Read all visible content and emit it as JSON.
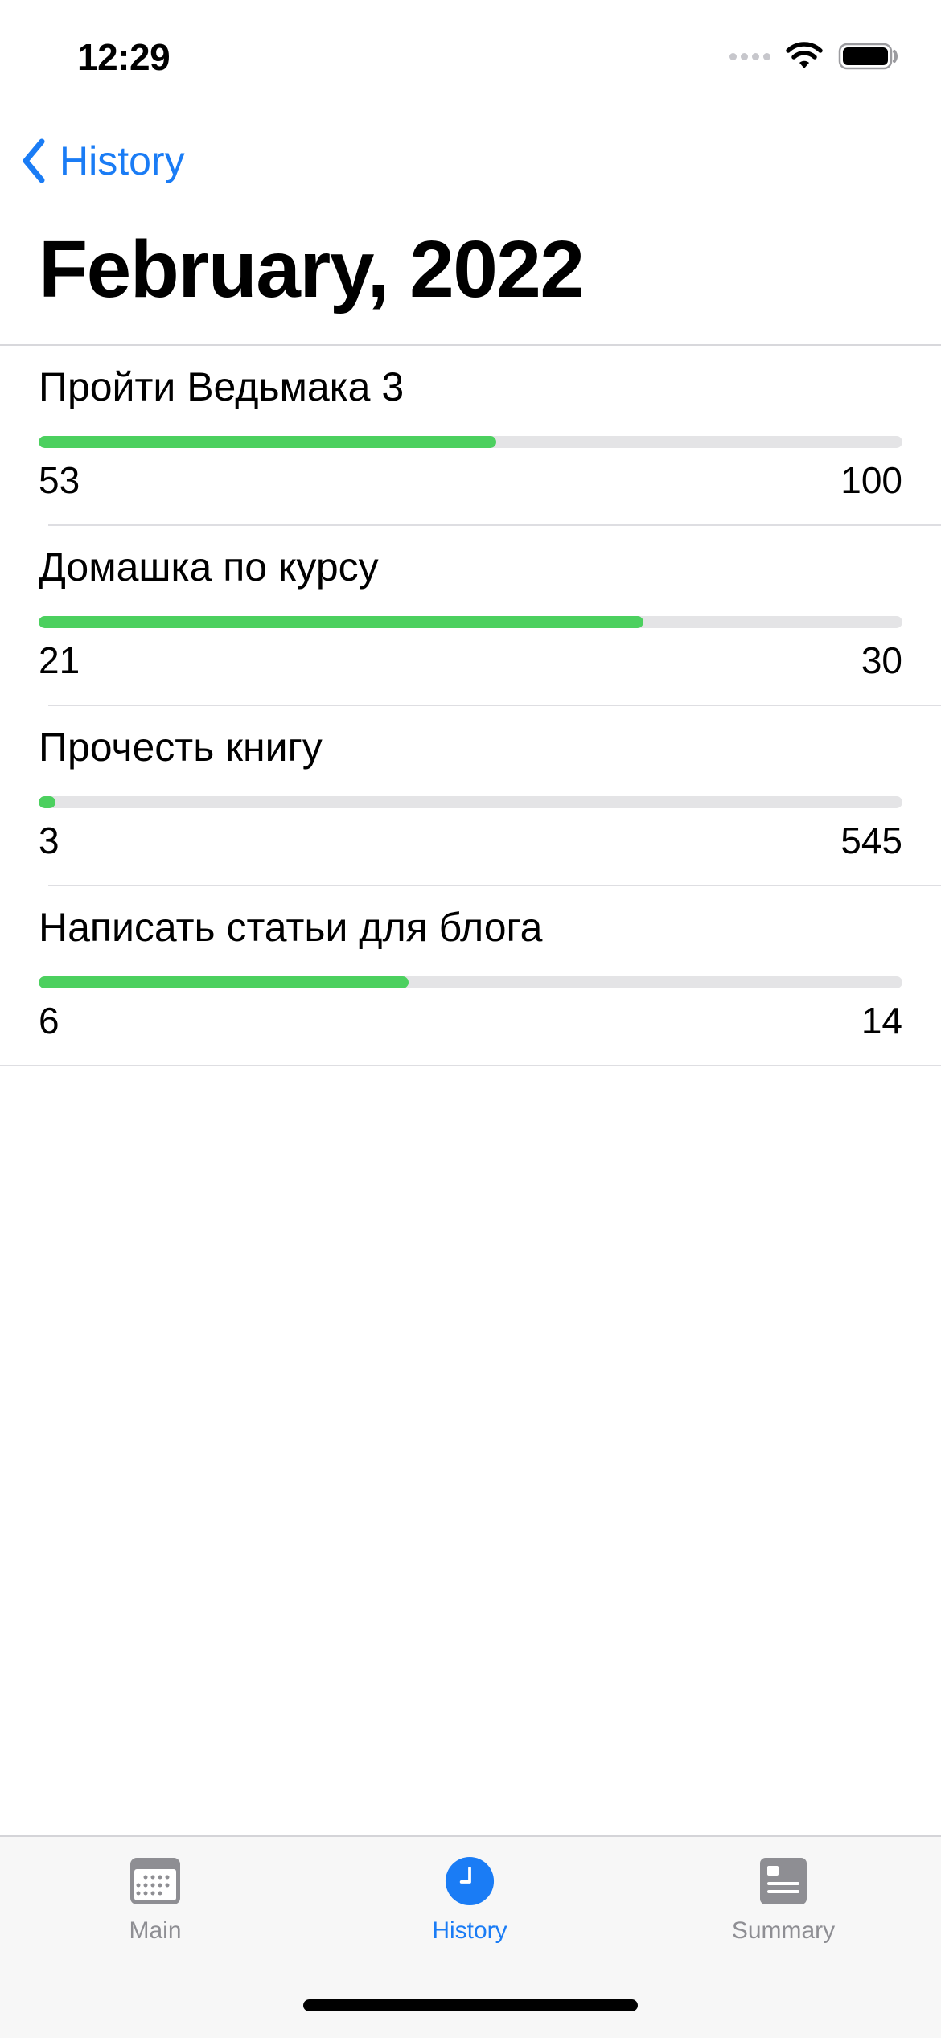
{
  "status_bar": {
    "time": "12:29"
  },
  "nav": {
    "back_label": "History",
    "title": "February, 2022"
  },
  "goals": [
    {
      "title": "Пройти Ведьмака 3",
      "current": "53",
      "total": "100",
      "progress": 0.53
    },
    {
      "title": "Домашка по курсу",
      "current": "21",
      "total": "30",
      "progress": 0.7
    },
    {
      "title": "Прочесть книгу",
      "current": "3",
      "total": "545",
      "progress": 0.0055
    },
    {
      "title": "Написать статьи для блога",
      "current": "6",
      "total": "14",
      "progress": 0.4286
    }
  ],
  "tab_bar": {
    "tabs": [
      {
        "label": "Main",
        "icon": "calendar-icon",
        "active": false
      },
      {
        "label": "History",
        "icon": "clock-icon",
        "active": true
      },
      {
        "label": "Summary",
        "icon": "summary-icon",
        "active": false
      }
    ]
  },
  "colors": {
    "accent": "#1a7cf5",
    "progress": "#4cd05f",
    "track": "#e4e4e6",
    "inactive": "#8e8e93"
  }
}
